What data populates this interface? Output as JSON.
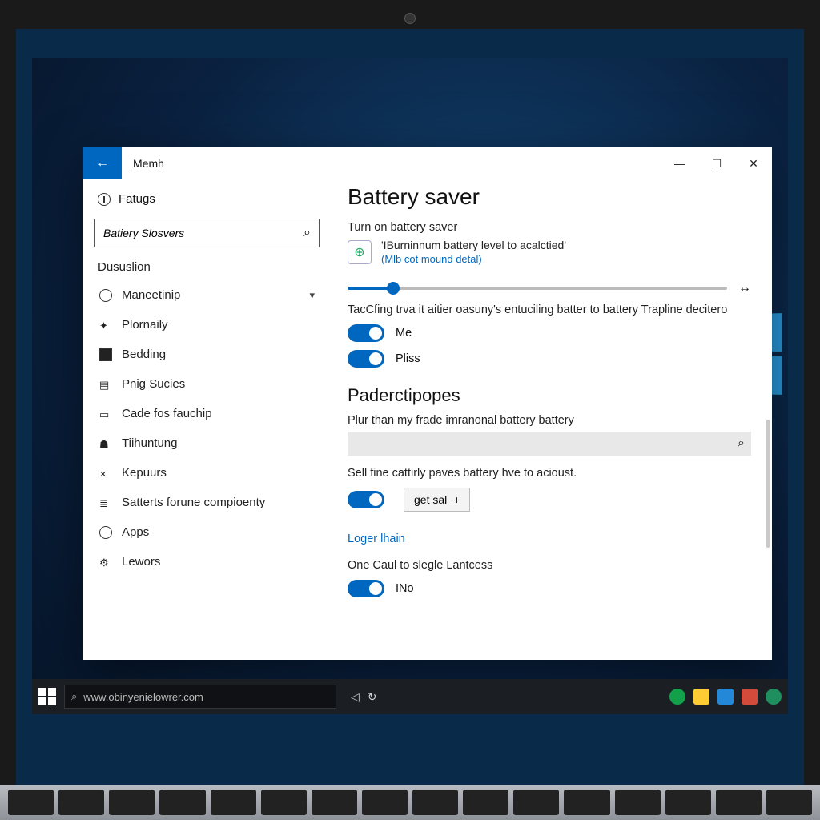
{
  "titlebar": {
    "title": "Memh"
  },
  "sidebar": {
    "home_label": "Fatugs",
    "search_value": "Batiery Slosvers",
    "section_label": "Dususlion",
    "items": [
      {
        "label": "Maneetinip",
        "has_chevron": true
      },
      {
        "label": "Plornaily"
      },
      {
        "label": "Bedding"
      },
      {
        "label": "Pnig Sucies"
      },
      {
        "label": "Cade fos fauchip"
      },
      {
        "label": "Tiihuntung"
      },
      {
        "label": "Kepuurs"
      },
      {
        "label": "Satterts forune compioenty"
      },
      {
        "label": "Apps"
      },
      {
        "label": "Lewors"
      }
    ]
  },
  "main": {
    "page_title": "Battery saver",
    "turn_on_label": "Turn on battery saver",
    "info_line1": "'IBurninnum battery level to acalctied'",
    "info_line2": "(Mlb cot mound detal)",
    "slider_percent": 12,
    "desc1": "TacCfing trva it aitier oasuny's entuciling batter to battery Trapline decitero",
    "toggle1_label": "Me",
    "toggle2_label": "Pliss",
    "section2_title": "Paderctipopes",
    "desc2": "Plur than my frade imranonal battery battery",
    "desc3": "Sell fine cattirly paves battery hve to acioust.",
    "mini_btn_label": "get sal",
    "link_label": "Loger lhain",
    "desc4": "One Caul to slegle Lantcess",
    "toggle4_label": "INo"
  },
  "taskbar": {
    "search_text": "www.obinyenielowrer.com"
  }
}
